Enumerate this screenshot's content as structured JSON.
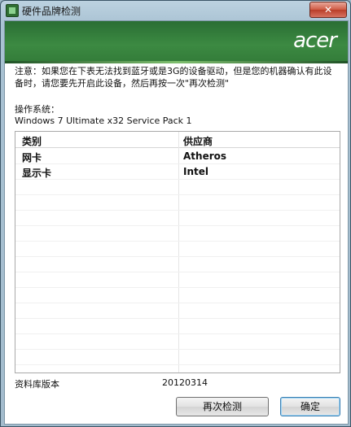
{
  "window": {
    "title": "硬件品牌检测",
    "close_symbol": "✕"
  },
  "banner": {
    "logo": "acer"
  },
  "notice": "注意：如果您在下表无法找到蓝牙或是3G的设备驱动，但是您的机器确认有此设备时，请您要先开启此设备，然后再按一次\"再次检测\"",
  "os": {
    "label": "操作系统：",
    "value": "Windows 7 Ultimate x32 Service Pack 1"
  },
  "table": {
    "headers": [
      "类别",
      "供应商"
    ],
    "rows": [
      {
        "category": "网卡",
        "vendor": "Atheros"
      },
      {
        "category": "显示卡",
        "vendor": "Intel"
      }
    ]
  },
  "library": {
    "label": "资料库版本",
    "value": "20120314"
  },
  "buttons": {
    "retry": "再次检测",
    "ok": "确定"
  }
}
